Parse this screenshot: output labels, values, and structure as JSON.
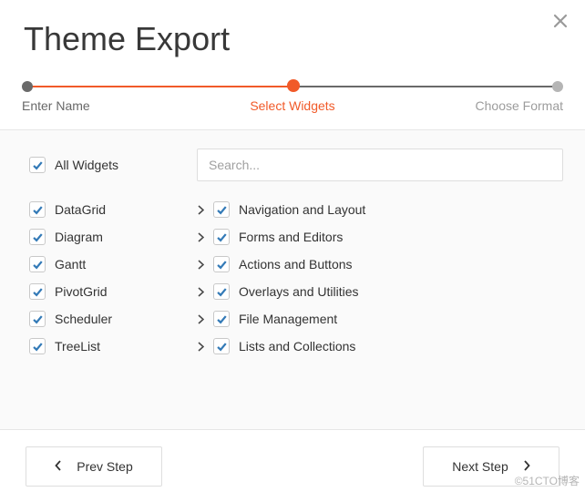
{
  "dialog_title": "Theme Export",
  "close_label": "Close",
  "steps": [
    {
      "label": "Enter Name",
      "state": "past"
    },
    {
      "label": "Select Widgets",
      "state": "current"
    },
    {
      "label": "Choose Format",
      "state": "future"
    }
  ],
  "all_widgets_label": "All Widgets",
  "search": {
    "placeholder": "Search..."
  },
  "left_widgets": [
    {
      "label": "DataGrid",
      "checked": true
    },
    {
      "label": "Diagram",
      "checked": true
    },
    {
      "label": "Gantt",
      "checked": true
    },
    {
      "label": "PivotGrid",
      "checked": true
    },
    {
      "label": "Scheduler",
      "checked": true
    },
    {
      "label": "TreeList",
      "checked": true
    }
  ],
  "right_groups": [
    {
      "label": "Navigation and Layout",
      "checked": true
    },
    {
      "label": "Forms and Editors",
      "checked": true
    },
    {
      "label": "Actions and Buttons",
      "checked": true
    },
    {
      "label": "Overlays and Utilities",
      "checked": true
    },
    {
      "label": "File Management",
      "checked": true
    },
    {
      "label": "Lists and Collections",
      "checked": true
    }
  ],
  "nav": {
    "prev_label": "Prev Step",
    "next_label": "Next Step"
  },
  "watermark": "©51CTO博客"
}
